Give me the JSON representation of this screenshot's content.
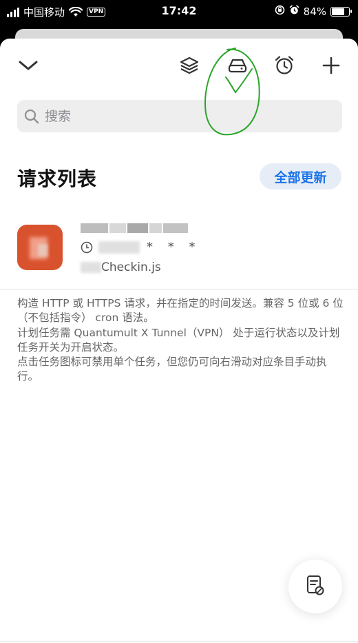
{
  "status_bar": {
    "carrier": "中国移动",
    "vpn_badge": "VPN",
    "time": "17:42",
    "battery_percent": "84%",
    "battery_level": 0.84
  },
  "nav": {
    "icons": [
      "chevron-down-icon",
      "layers-icon",
      "drive-icon",
      "alarm-icon",
      "plus-icon"
    ]
  },
  "search": {
    "placeholder": "搜索",
    "value": ""
  },
  "section": {
    "title": "请求列表",
    "update_all_label": "全部更新"
  },
  "task": {
    "schedule_stars": "* * *",
    "script_suffix": "Checkin.js",
    "icon_color": "#d9522e"
  },
  "description": [
    "构造 HTTP 或 HTTPS 请求，并在指定的时间发送。兼容 5 位或 6 位（不包括指令） cron 语法。",
    "计划任务需 Quantumult X Tunnel（VPN） 处于运行状态以及计划任务开关为开启状态。",
    "点击任务图标可禁用单个任务，但您仍可向右滑动对应条目手动执行。"
  ],
  "colors": {
    "accent": "#1a73e8",
    "annotation": "#2aa52a"
  }
}
